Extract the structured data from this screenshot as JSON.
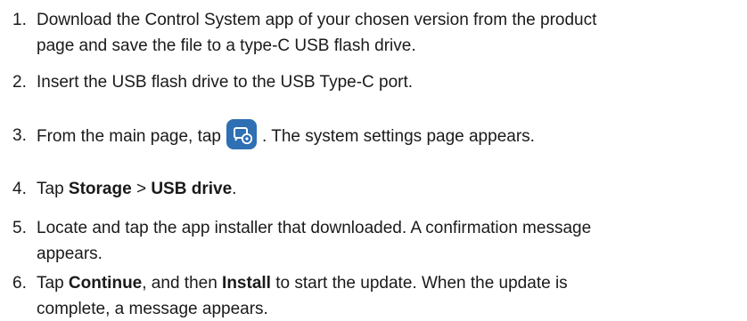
{
  "steps": [
    {
      "number": "1.",
      "line1": "Download the Control System app of your chosen version from the product",
      "line2": "page and save the file to a type-C USB flash drive."
    },
    {
      "number": "2.",
      "text": "Insert the USB flash drive to the USB Type-C port."
    },
    {
      "number": "3.",
      "before": "From the main page, tap",
      "icon": "system-settings-icon",
      "after": ". The system settings page appears."
    },
    {
      "number": "4.",
      "prefix": "Tap ",
      "bold1": "Storage",
      "sep": " > ",
      "bold2": "USB drive",
      "suffix": "."
    },
    {
      "number": "5.",
      "line1": "Locate and tap the app installer that downloaded. A confirmation message",
      "line2": "appears."
    },
    {
      "number": "6.",
      "prefix": "Tap ",
      "bold1": "Continue",
      "mid": ", and then ",
      "bold2": "Install",
      "suffix": " to start the update. When the update is",
      "line2": "complete, a message appears."
    }
  ],
  "colors": {
    "text": "#1a1a1a",
    "icon_bg": "#2f6fb3"
  }
}
